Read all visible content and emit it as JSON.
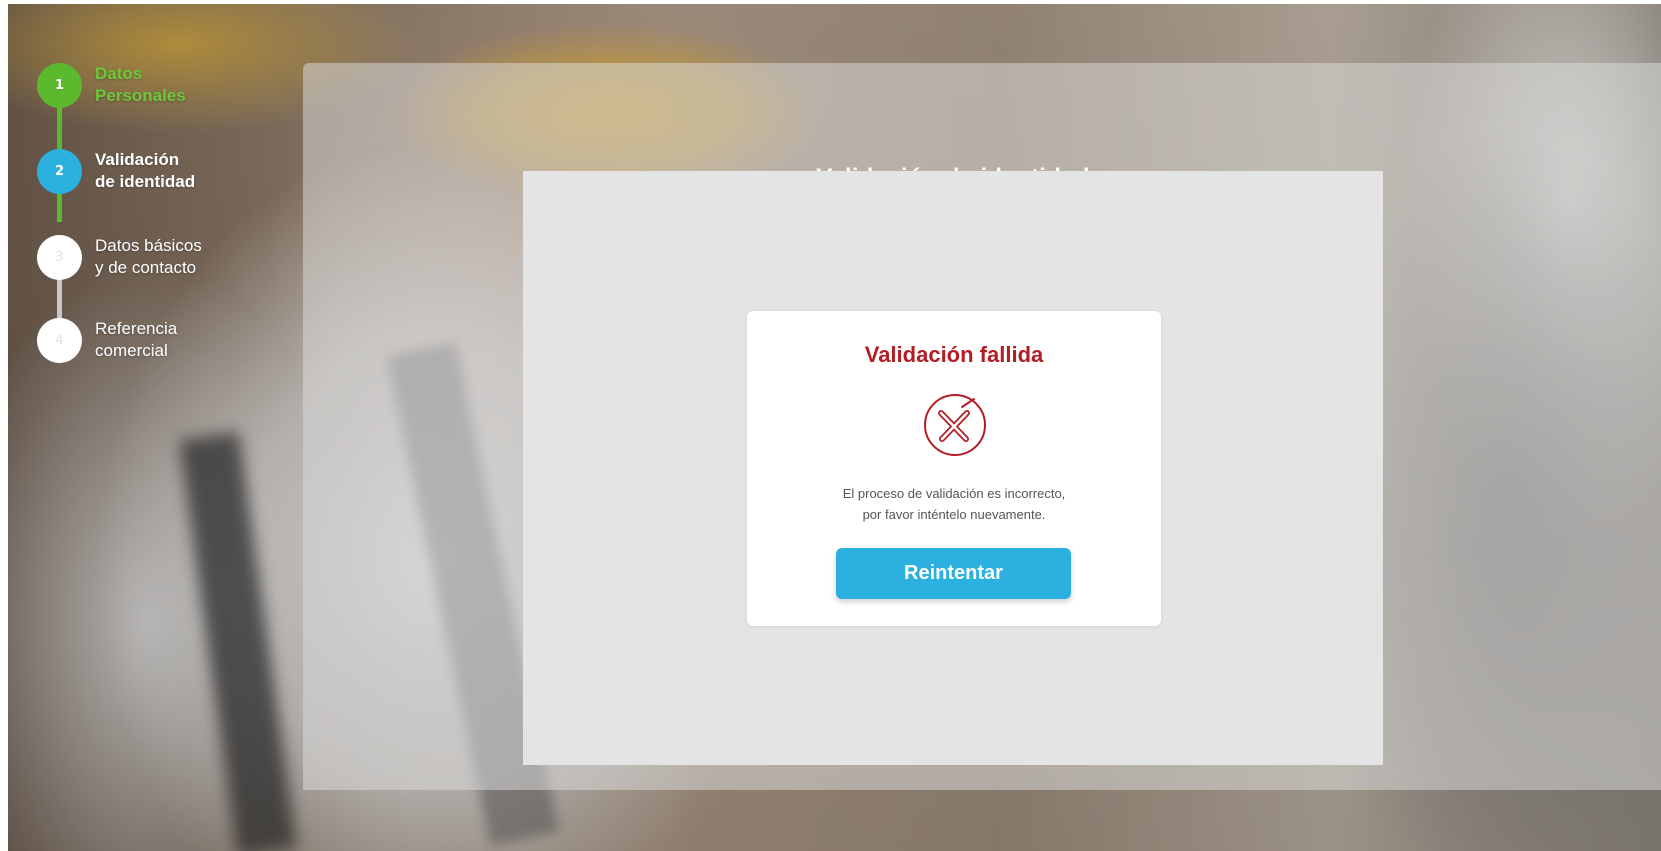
{
  "stepper": {
    "steps": [
      {
        "number": "1",
        "label_line1": "Datos",
        "label_line2": "Personales",
        "state": "completed"
      },
      {
        "number": "2",
        "label_line1": "Validación",
        "label_line2": "de identidad",
        "state": "active"
      },
      {
        "number": "3",
        "label_line1": "Datos básicos",
        "label_line2": "y de contacto",
        "state": "pending"
      },
      {
        "number": "4",
        "label_line1": "Referencia",
        "label_line2": "comercial",
        "state": "pending"
      }
    ],
    "colors": {
      "completed": "#5cb82d",
      "active": "#2bb0e0",
      "pending": "#ffffff",
      "connector_done": "#5cb82d",
      "connector_pending": "#c8c8c8"
    }
  },
  "main": {
    "title": "Validación de identidad"
  },
  "result_card": {
    "title": "Validación fallida",
    "icon": "x-circle-icon",
    "message_line1": "El proceso de validación es incorrecto,",
    "message_line2": "por favor inténtelo nuevamente.",
    "retry_label": "Reintentar",
    "colors": {
      "error": "#b31e24",
      "button": "#2bb0e0"
    }
  }
}
